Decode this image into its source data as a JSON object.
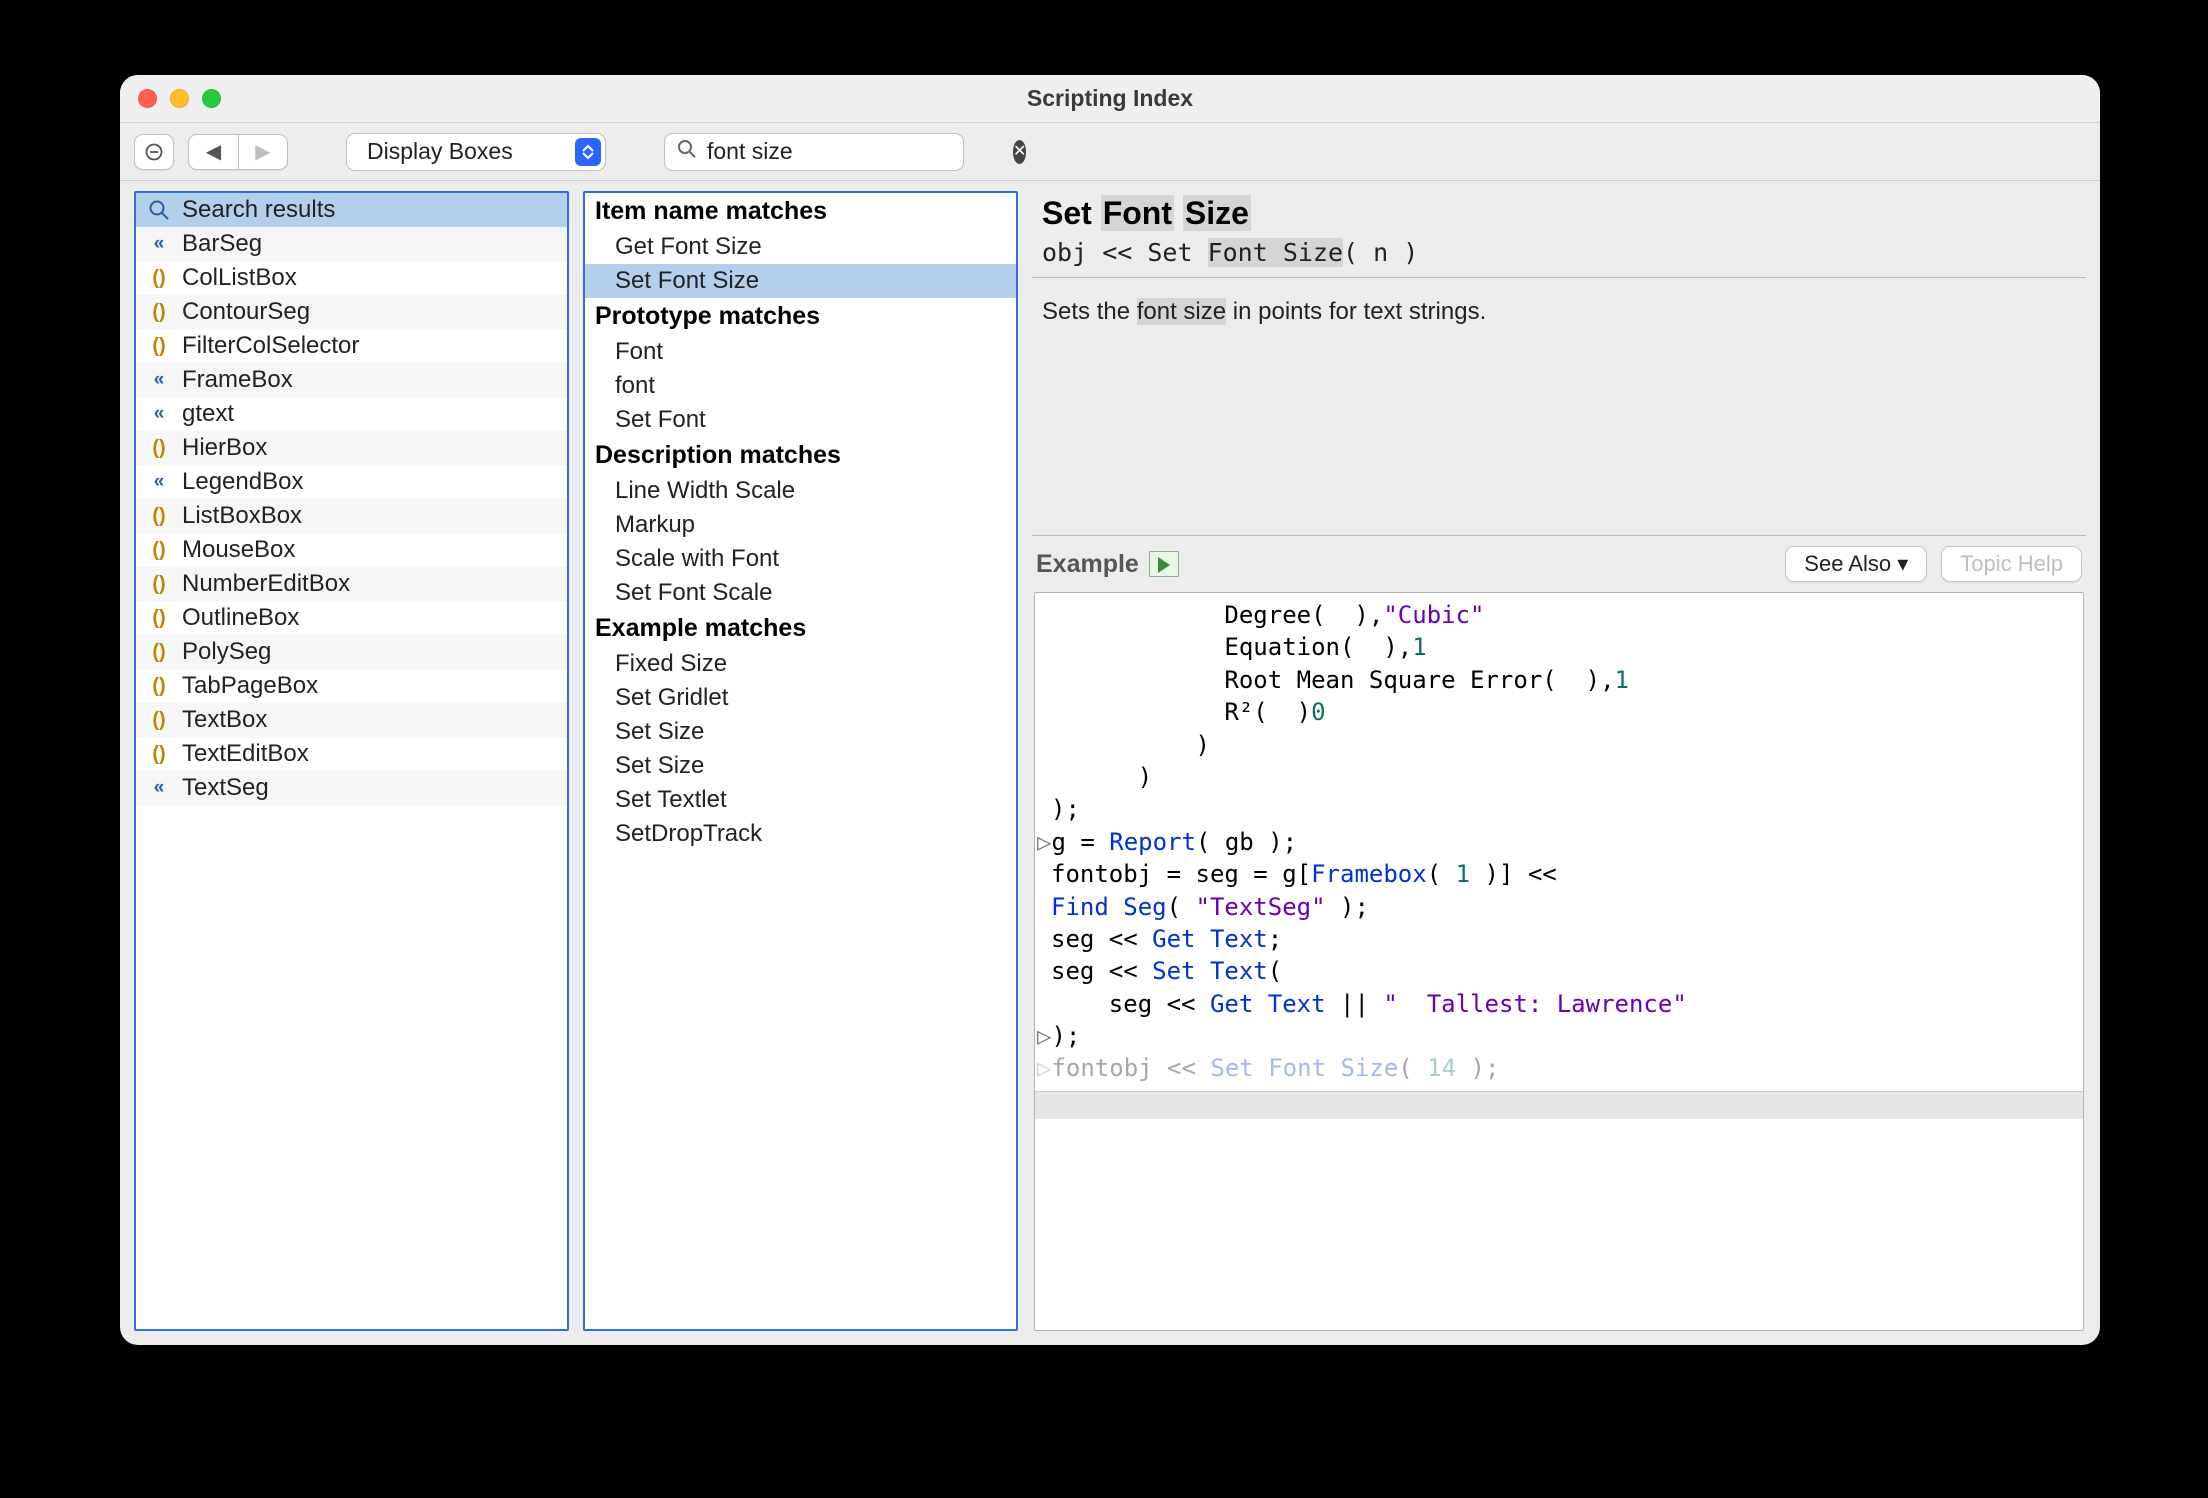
{
  "window": {
    "title": "Scripting Index"
  },
  "toolbar": {
    "minus_tooltip": "Remove",
    "dropdown_value": "Display Boxes",
    "search_placeholder": "Search",
    "search_value": "font size"
  },
  "left_panel": {
    "items": [
      {
        "icon": "mag",
        "label": "Search results",
        "selected": true
      },
      {
        "icon": "dbl",
        "label": "BarSeg"
      },
      {
        "icon": "par",
        "label": "ColListBox"
      },
      {
        "icon": "par",
        "label": "ContourSeg"
      },
      {
        "icon": "par",
        "label": "FilterColSelector"
      },
      {
        "icon": "dbl",
        "label": "FrameBox"
      },
      {
        "icon": "dbl",
        "label": "gtext"
      },
      {
        "icon": "par",
        "label": "HierBox"
      },
      {
        "icon": "dbl",
        "label": "LegendBox"
      },
      {
        "icon": "par",
        "label": "ListBoxBox"
      },
      {
        "icon": "par",
        "label": "MouseBox"
      },
      {
        "icon": "par",
        "label": "NumberEditBox"
      },
      {
        "icon": "par",
        "label": "OutlineBox"
      },
      {
        "icon": "par",
        "label": "PolySeg"
      },
      {
        "icon": "par",
        "label": "TabPageBox"
      },
      {
        "icon": "par",
        "label": "TextBox"
      },
      {
        "icon": "par",
        "label": "TextEditBox"
      },
      {
        "icon": "dbl",
        "label": "TextSeg"
      }
    ]
  },
  "mid_panel": {
    "sections": [
      {
        "header": "Item name matches",
        "items": [
          "Get Font Size",
          "Set Font Size"
        ],
        "selected_index": 1
      },
      {
        "header": "Prototype matches",
        "items": [
          "Font",
          "font",
          "Set Font"
        ]
      },
      {
        "header": "Description matches",
        "items": [
          "Line Width Scale",
          "Markup",
          "Scale with Font",
          "Set Font Scale"
        ]
      },
      {
        "header": "Example matches",
        "items": [
          "Fixed Size",
          "Set Gridlet",
          "Set Size",
          "Set Size",
          "Set Textlet",
          "SetDropTrack"
        ]
      }
    ]
  },
  "doc": {
    "title_prefix": "Set ",
    "title_hl1": "Font",
    "title_mid": " ",
    "title_hl2": "Size",
    "syntax_prefix": "obj << Set ",
    "syntax_hl": "Font Size",
    "syntax_suffix": "( n )",
    "desc_prefix": "Sets the ",
    "desc_hl": "font size",
    "desc_suffix": " in points for text strings."
  },
  "example": {
    "label": "Example",
    "see_also_label": "See Also ▾",
    "topic_help_label": "Topic Help",
    "code_tokens": [
      {
        "indent": 12,
        "t": "",
        "plain": "Degree( ",
        "purple": "\"Cubic\"",
        "tail": " ),"
      },
      {
        "indent": 12,
        "plain": "Equation( ",
        "num": "1",
        "tail": " ),"
      },
      {
        "indent": 12,
        "plain": "Root Mean Square Error( ",
        "num": "1",
        "tail": " ),"
      },
      {
        "indent": 12,
        "plain2": "R²( ",
        "num": "0",
        "tail": " )"
      },
      {
        "indent": 10,
        "plain": ")"
      },
      {
        "indent": 6,
        "plain": ")"
      },
      {
        "indent": 0,
        "plain": ");"
      },
      {
        "indent": 0,
        "arrow": true,
        "plain": "g = ",
        "blue": "Report",
        "tail": "( gb );"
      },
      {
        "indent": 0,
        "plain": "fontobj = seg = g[",
        "blue": "Framebox",
        "tail": "( ",
        "num": "1",
        "tail2": " )] <<"
      },
      {
        "indent": 0,
        "blue": "Find Seg",
        "tail": "( ",
        "purple": "\"TextSeg\"",
        "tail2": " );"
      },
      {
        "indent": 0,
        "plain": "seg << ",
        "blue": "Get Text",
        "tail": ";"
      },
      {
        "indent": 0,
        "plain": "seg << ",
        "blue": "Set Text",
        "tail": "("
      },
      {
        "indent": 4,
        "plain": "seg << ",
        "blue": "Get Text",
        "tail": " || ",
        "purple": "\"  Tallest: Lawrence\""
      },
      {
        "indent": 0,
        "arrow": true,
        "plain": ");"
      },
      {
        "indent": 0,
        "arrow": true,
        "plain": "fontobj << ",
        "blue": "Set Font Size",
        "tail": "( ",
        "num": "14",
        "tail2": " );",
        "faded": true
      }
    ]
  }
}
